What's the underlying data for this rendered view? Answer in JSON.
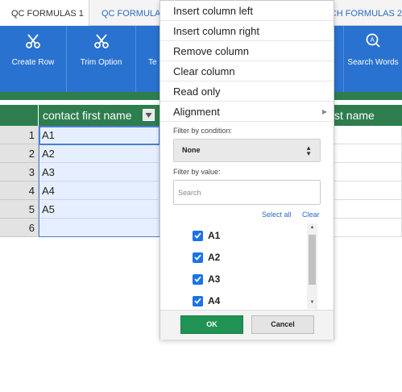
{
  "tabs": [
    {
      "label": "QC FORMULAS 1"
    },
    {
      "label": "QC FORMULAS"
    },
    {
      "label": "CH FORMULAS 2"
    }
  ],
  "toolbar": [
    {
      "label": "Create Row",
      "icon": "scissors-icon"
    },
    {
      "label": "Trim Option",
      "icon": "scissors-icon"
    },
    {
      "label": "Te",
      "icon": "none"
    },
    {
      "label": "Search Words",
      "icon": "search-icon"
    }
  ],
  "grid": {
    "columns": [
      "contact first name",
      "st name"
    ],
    "rows": [
      {
        "num": "1",
        "value": "A1"
      },
      {
        "num": "2",
        "value": "A2"
      },
      {
        "num": "3",
        "value": "A3"
      },
      {
        "num": "4",
        "value": "A4"
      },
      {
        "num": "5",
        "value": "A5"
      },
      {
        "num": "6",
        "value": ""
      }
    ]
  },
  "dropdown": {
    "menu": [
      {
        "label": "Insert column left"
      },
      {
        "label": "Insert column right"
      },
      {
        "label": "Remove column"
      },
      {
        "label": "Clear column"
      },
      {
        "label": "Read only"
      },
      {
        "label": "Alignment",
        "submenu": true
      }
    ],
    "filter_by_condition_label": "Filter by condition:",
    "condition_value": "None",
    "filter_by_value_label": "Filter by value:",
    "search_placeholder": "Search",
    "select_all": "Select all",
    "clear": "Clear",
    "values": [
      {
        "label": "A1",
        "checked": true
      },
      {
        "label": "A2",
        "checked": true
      },
      {
        "label": "A3",
        "checked": true
      },
      {
        "label": "A4",
        "checked": true
      }
    ],
    "ok": "OK",
    "cancel": "Cancel"
  },
  "colors": {
    "toolbar": "#2a72cf",
    "header_green": "#2e7d4f",
    "ok_green": "#1f9254",
    "checkbox_blue": "#1a73e8",
    "selection_fill": "#e6efff"
  }
}
